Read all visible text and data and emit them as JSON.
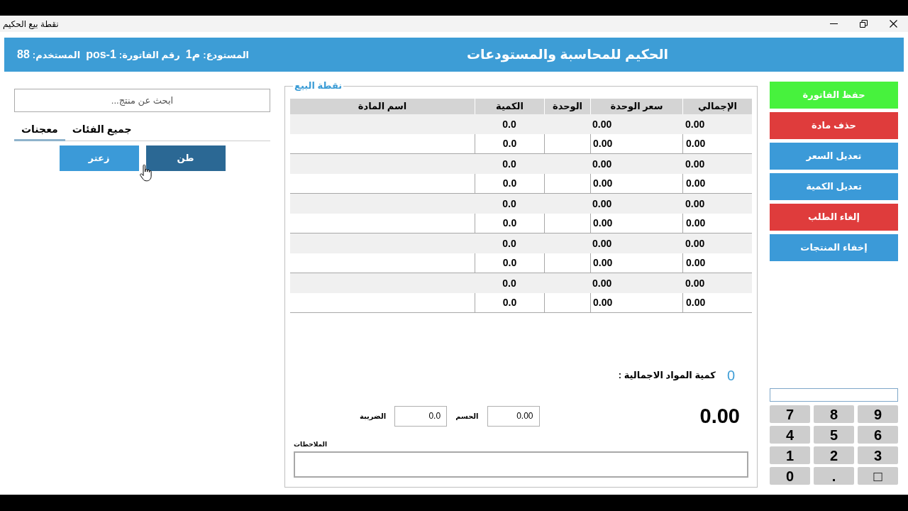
{
  "window": {
    "title": "نقطة بيع الحكيم"
  },
  "header": {
    "info": [
      {
        "label": "المستودع:",
        "value": "م1"
      },
      {
        "label": "رقم الفاتورة:",
        "value": "pos-1"
      },
      {
        "label": "المستخدم:",
        "value": "88"
      }
    ],
    "title": "الحكيم للمحاسبة والمستودعات"
  },
  "products": {
    "search": {
      "placeholder": "ابحث عن منتج..."
    },
    "tabs": [
      {
        "label": "جميع الفئات",
        "selected": false
      },
      {
        "label": "معجنات",
        "selected": true
      }
    ],
    "items": [
      {
        "label": "طن",
        "hovered": true
      },
      {
        "label": "زعتر",
        "hovered": false
      }
    ]
  },
  "sale": {
    "legend": "نقطة البيع",
    "table": {
      "columns": [
        "الإجمالي",
        "سعر الوحدة",
        "الوحدة",
        "الكمية",
        "اسم المادة"
      ],
      "rows": [
        [
          "0.00",
          "0.00",
          null,
          "0.0",
          null
        ],
        [
          "0.00",
          "0.00",
          null,
          "0.0",
          null
        ],
        [
          "0.00",
          "0.00",
          null,
          "0.0",
          null
        ],
        [
          "0.00",
          "0.00",
          null,
          "0.0",
          null
        ],
        [
          "0.00",
          "0.00",
          null,
          "0.0",
          null
        ],
        [
          "0.00",
          "0.00",
          null,
          "0.0",
          null
        ],
        [
          "0.00",
          "0.00",
          null,
          "0.0",
          null
        ],
        [
          "0.00",
          "0.00",
          null,
          "0.0",
          null
        ],
        [
          "0.00",
          "0.00",
          null,
          "0.0",
          null
        ],
        [
          "0.00",
          "0.00",
          null,
          "0.0",
          null
        ]
      ]
    },
    "total_items": {
      "label": "كمية المواد الاجمالية :",
      "value": "0"
    },
    "grand_total": "0.00",
    "discount": {
      "label": "الحسم",
      "value": "0.00"
    },
    "tax": {
      "label": "الضريبة",
      "value": "0.0"
    },
    "notes": {
      "label": "الملاحظات"
    }
  },
  "actions": [
    {
      "label": "حفظ الفاتورة",
      "color": "#47f23d"
    },
    {
      "label": "حذف مادة",
      "color": "#df3c3c"
    },
    {
      "label": "تعديل السعر",
      "color": "#3b9ad8"
    },
    {
      "label": "تعديل الكمية",
      "color": "#3b9ad8"
    },
    {
      "label": "إلغاء الطلب",
      "color": "#df3c3c"
    },
    {
      "label": "إخفاء المنتجات",
      "color": "#3b9ad8"
    }
  ],
  "keypad": {
    "keys": [
      "9",
      "8",
      "7",
      "6",
      "5",
      "4",
      "3",
      "2",
      "1",
      "□",
      ".",
      "0"
    ]
  }
}
